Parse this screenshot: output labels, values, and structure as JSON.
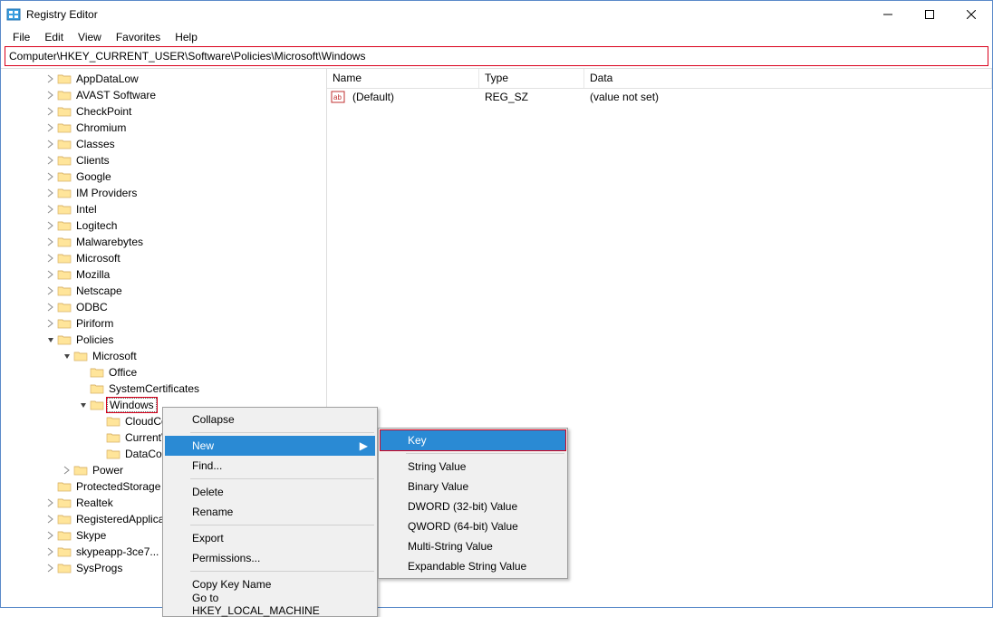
{
  "window": {
    "title": "Registry Editor"
  },
  "menubar": [
    "File",
    "Edit",
    "View",
    "Favorites",
    "Help"
  ],
  "addressbar": "Computer\\HKEY_CURRENT_USER\\Software\\Policies\\Microsoft\\Windows",
  "tree": [
    {
      "level": 1,
      "chev": "right",
      "label": "AppDataLow"
    },
    {
      "level": 1,
      "chev": "right",
      "label": "AVAST Software"
    },
    {
      "level": 1,
      "chev": "right",
      "label": "CheckPoint"
    },
    {
      "level": 1,
      "chev": "right",
      "label": "Chromium"
    },
    {
      "level": 1,
      "chev": "right",
      "label": "Classes"
    },
    {
      "level": 1,
      "chev": "right",
      "label": "Clients"
    },
    {
      "level": 1,
      "chev": "right",
      "label": "Google"
    },
    {
      "level": 1,
      "chev": "right",
      "label": "IM Providers"
    },
    {
      "level": 1,
      "chev": "right",
      "label": "Intel"
    },
    {
      "level": 1,
      "chev": "right",
      "label": "Logitech"
    },
    {
      "level": 1,
      "chev": "right",
      "label": "Malwarebytes"
    },
    {
      "level": 1,
      "chev": "right",
      "label": "Microsoft"
    },
    {
      "level": 1,
      "chev": "right",
      "label": "Mozilla"
    },
    {
      "level": 1,
      "chev": "right",
      "label": "Netscape"
    },
    {
      "level": 1,
      "chev": "right",
      "label": "ODBC"
    },
    {
      "level": 1,
      "chev": "right",
      "label": "Piriform"
    },
    {
      "level": 1,
      "chev": "down",
      "label": "Policies"
    },
    {
      "level": 2,
      "chev": "down",
      "label": "Microsoft"
    },
    {
      "level": 3,
      "chev": "none",
      "label": "Office"
    },
    {
      "level": 3,
      "chev": "none",
      "label": "SystemCertificates"
    },
    {
      "level": 3,
      "chev": "down",
      "label": "Windows",
      "selected": true
    },
    {
      "level": 4,
      "chev": "none",
      "label": "CloudContent"
    },
    {
      "level": 4,
      "chev": "none",
      "label": "CurrentVersion"
    },
    {
      "level": 4,
      "chev": "none",
      "label": "DataCollection"
    },
    {
      "level": 2,
      "chev": "right",
      "label": "Power"
    },
    {
      "level": 1,
      "chev": "none",
      "label": "ProtectedStorage"
    },
    {
      "level": 1,
      "chev": "right",
      "label": "Realtek"
    },
    {
      "level": 1,
      "chev": "right",
      "label": "RegisteredApplications"
    },
    {
      "level": 1,
      "chev": "right",
      "label": "Skype"
    },
    {
      "level": 1,
      "chev": "right",
      "label": "skypeapp-3ce7..."
    },
    {
      "level": 1,
      "chev": "right",
      "label": "SysProgs"
    }
  ],
  "list": {
    "columns": {
      "name": "Name",
      "type": "Type",
      "data": "Data"
    },
    "rows": [
      {
        "name": "(Default)",
        "type": "REG_SZ",
        "data": "(value not set)"
      }
    ]
  },
  "context_main": [
    {
      "t": "item",
      "label": "Collapse"
    },
    {
      "t": "sep"
    },
    {
      "t": "item",
      "label": "New",
      "arrow": true,
      "hover": true
    },
    {
      "t": "item",
      "label": "Find..."
    },
    {
      "t": "sep"
    },
    {
      "t": "item",
      "label": "Delete"
    },
    {
      "t": "item",
      "label": "Rename"
    },
    {
      "t": "sep"
    },
    {
      "t": "item",
      "label": "Export"
    },
    {
      "t": "item",
      "label": "Permissions..."
    },
    {
      "t": "sep"
    },
    {
      "t": "item",
      "label": "Copy Key Name"
    },
    {
      "t": "item",
      "label": "Go to HKEY_LOCAL_MACHINE"
    }
  ],
  "context_sub": [
    {
      "t": "item",
      "label": "Key",
      "hover": true,
      "hl": true
    },
    {
      "t": "sep"
    },
    {
      "t": "item",
      "label": "String Value"
    },
    {
      "t": "item",
      "label": "Binary Value"
    },
    {
      "t": "item",
      "label": "DWORD (32-bit) Value"
    },
    {
      "t": "item",
      "label": "QWORD (64-bit) Value"
    },
    {
      "t": "item",
      "label": "Multi-String Value"
    },
    {
      "t": "item",
      "label": "Expandable String Value"
    }
  ]
}
